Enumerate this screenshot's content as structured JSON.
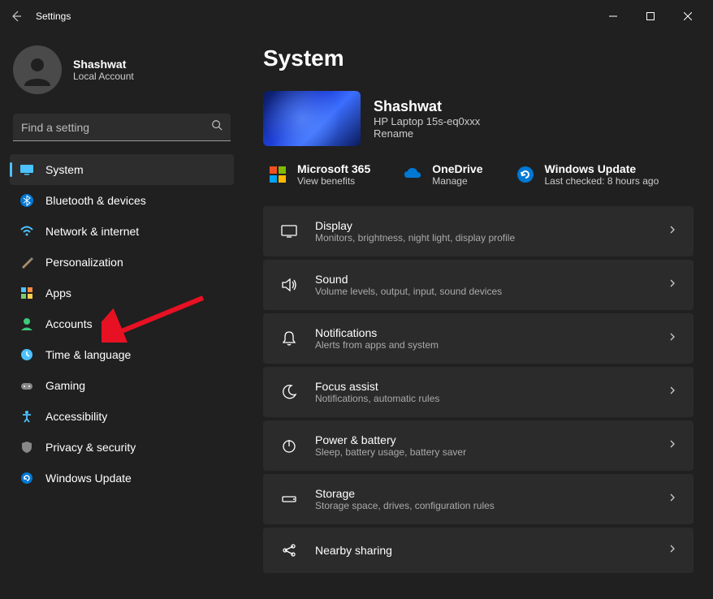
{
  "window": {
    "title": "Settings"
  },
  "profile": {
    "name": "Shashwat",
    "subtitle": "Local Account"
  },
  "search": {
    "placeholder": "Find a setting"
  },
  "nav": [
    {
      "id": "system",
      "label": "System",
      "active": true
    },
    {
      "id": "bluetooth",
      "label": "Bluetooth & devices"
    },
    {
      "id": "network",
      "label": "Network & internet"
    },
    {
      "id": "personalization",
      "label": "Personalization"
    },
    {
      "id": "apps",
      "label": "Apps"
    },
    {
      "id": "accounts",
      "label": "Accounts"
    },
    {
      "id": "time",
      "label": "Time & language"
    },
    {
      "id": "gaming",
      "label": "Gaming"
    },
    {
      "id": "accessibility",
      "label": "Accessibility"
    },
    {
      "id": "privacy",
      "label": "Privacy & security"
    },
    {
      "id": "update",
      "label": "Windows Update"
    }
  ],
  "page": {
    "title": "System"
  },
  "device": {
    "name": "Shashwat",
    "model": "HP Laptop 15s-eq0xxx",
    "rename": "Rename"
  },
  "quicklinks": [
    {
      "id": "m365",
      "title": "Microsoft 365",
      "sub": "View benefits"
    },
    {
      "id": "onedrive",
      "title": "OneDrive",
      "sub": "Manage"
    },
    {
      "id": "winupdate",
      "title": "Windows Update",
      "sub": "Last checked: 8 hours ago"
    }
  ],
  "settings": [
    {
      "id": "display",
      "title": "Display",
      "sub": "Monitors, brightness, night light, display profile"
    },
    {
      "id": "sound",
      "title": "Sound",
      "sub": "Volume levels, output, input, sound devices"
    },
    {
      "id": "notifications",
      "title": "Notifications",
      "sub": "Alerts from apps and system"
    },
    {
      "id": "focus",
      "title": "Focus assist",
      "sub": "Notifications, automatic rules"
    },
    {
      "id": "power",
      "title": "Power & battery",
      "sub": "Sleep, battery usage, battery saver"
    },
    {
      "id": "storage",
      "title": "Storage",
      "sub": "Storage space, drives, configuration rules"
    },
    {
      "id": "nearby",
      "title": "Nearby sharing",
      "sub": ""
    }
  ]
}
